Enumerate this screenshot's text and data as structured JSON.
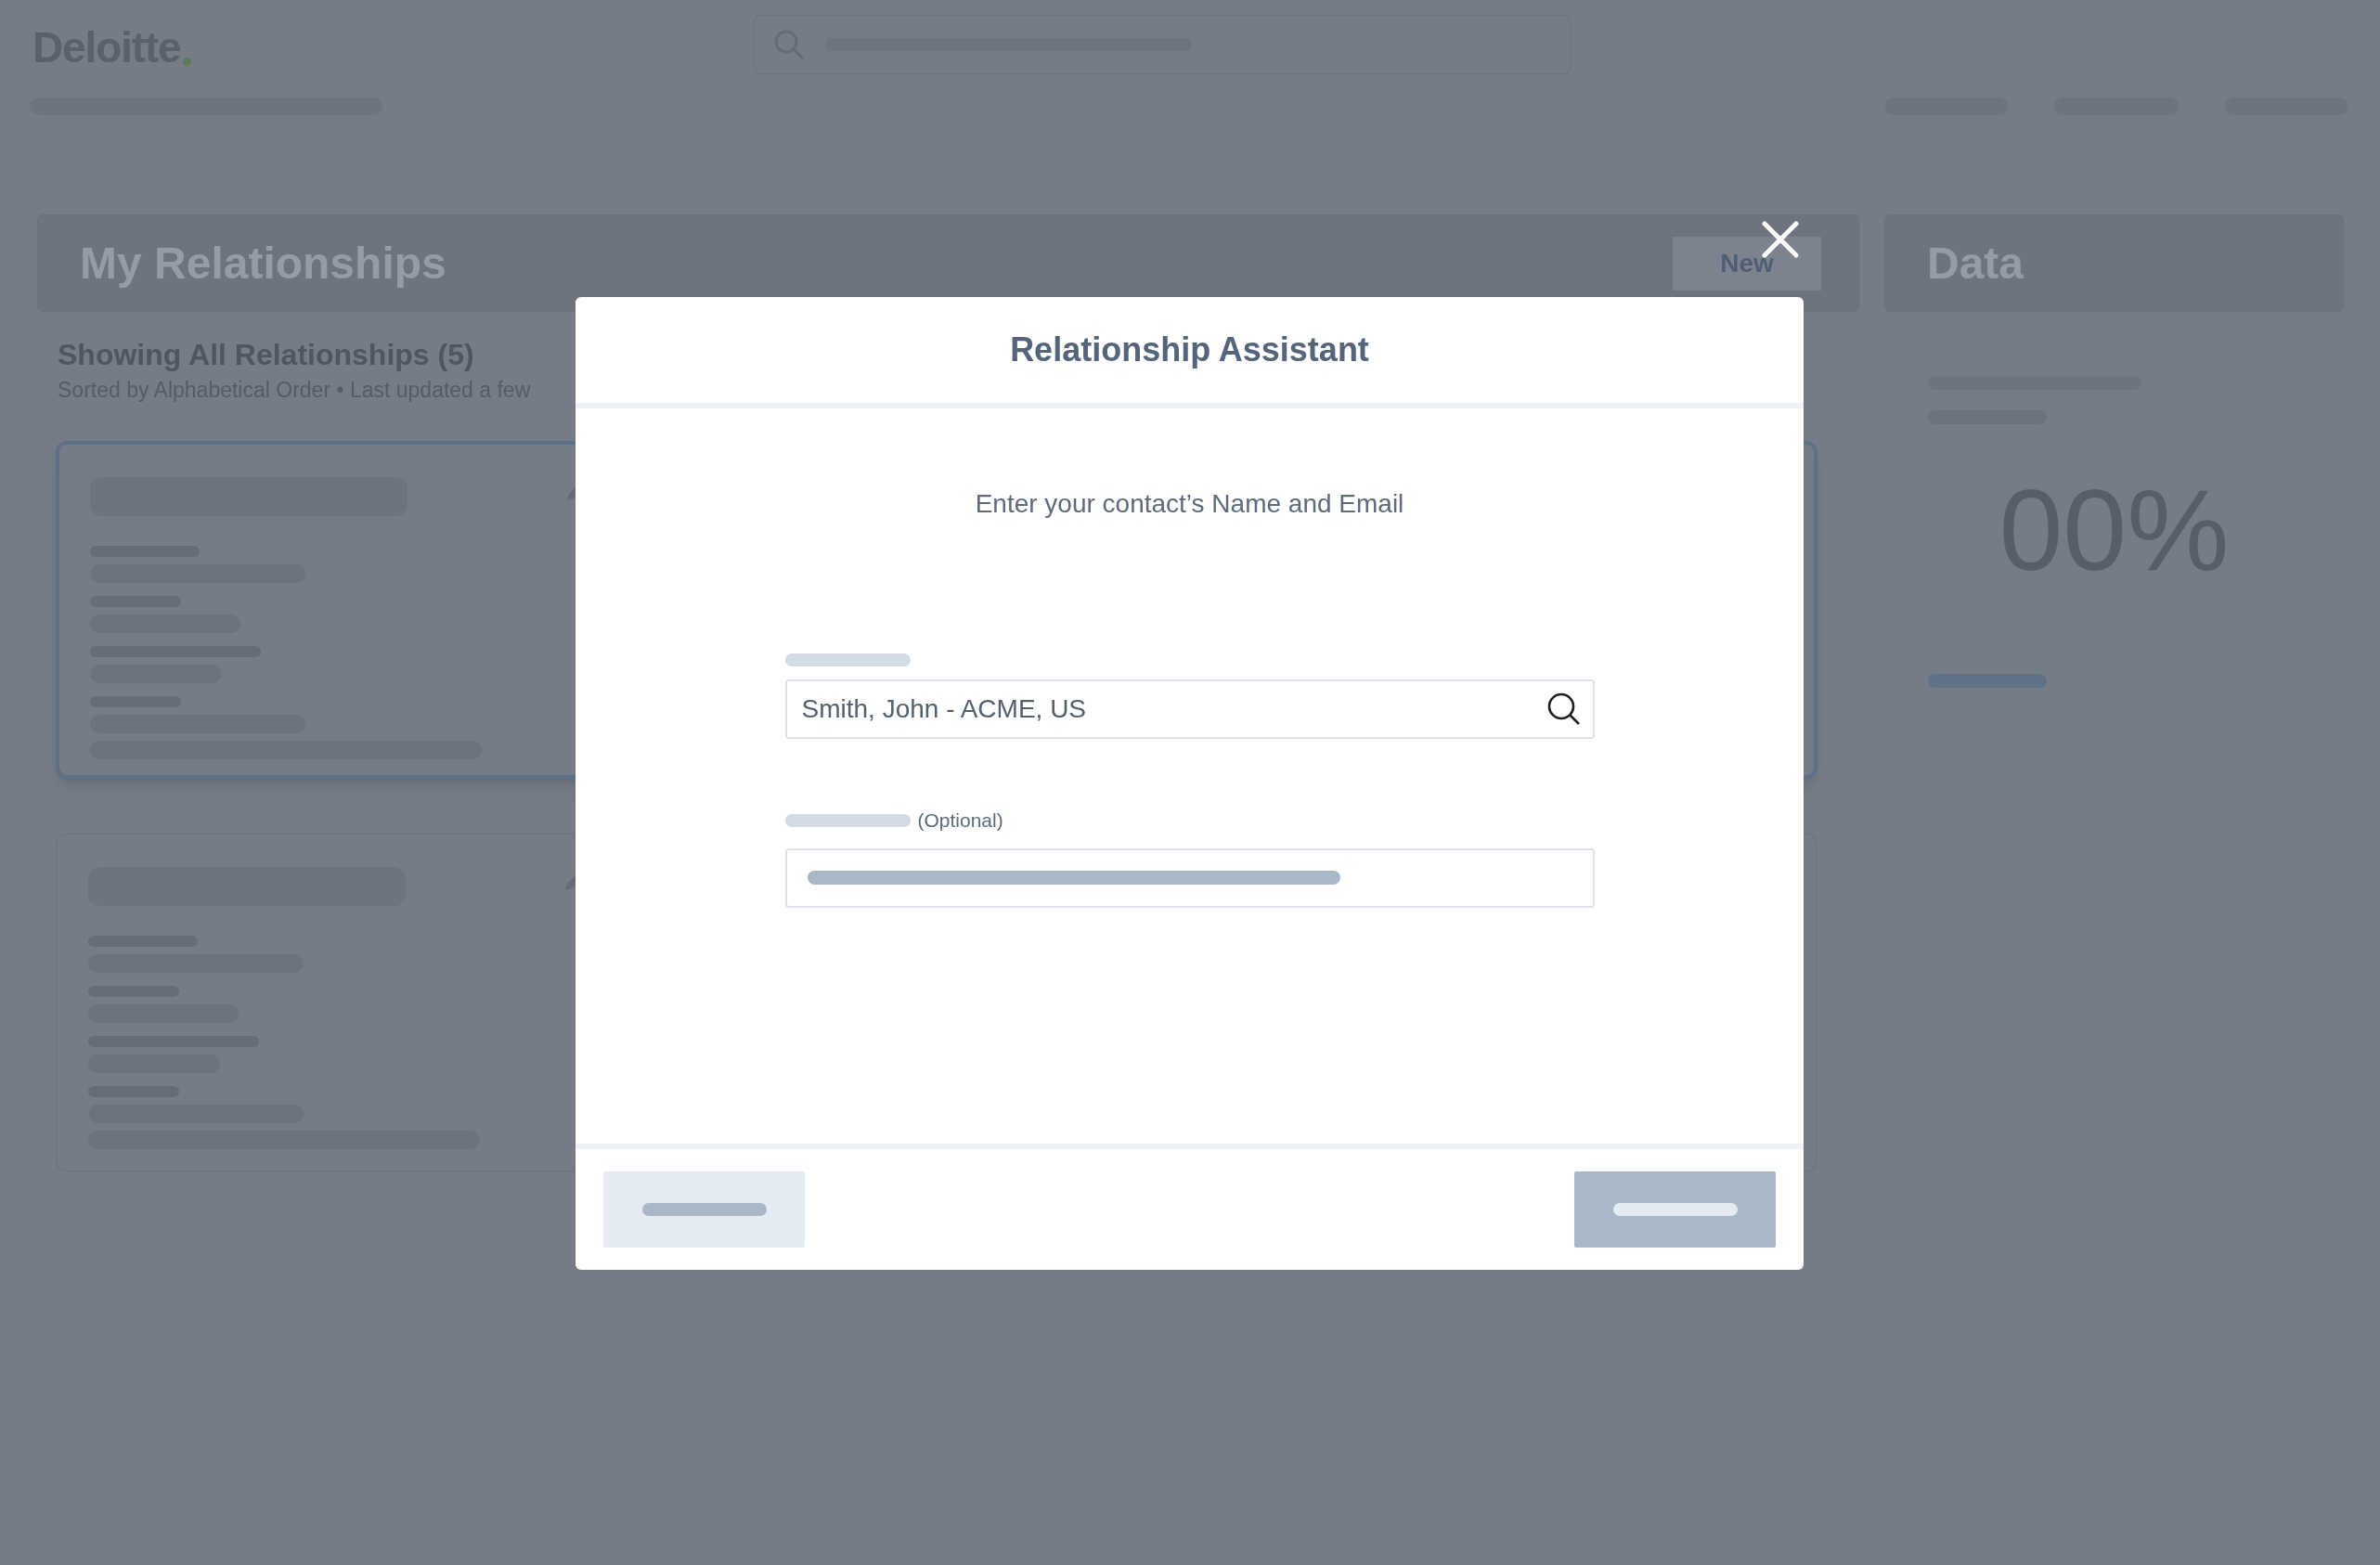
{
  "header": {
    "logo": "Deloitte"
  },
  "relationships_panel": {
    "title": "My Relationships",
    "new_button": "New",
    "heading": "Showing All Relationships (5)",
    "subheading": "Sorted by Alphabetical Order • Last updated a few"
  },
  "data_panel": {
    "title": "Data",
    "value": "00%"
  },
  "modal": {
    "title": "Relationship Assistant",
    "instruction": "Enter your contact’s Name and Email",
    "fields": [
      {
        "kind": "search",
        "value": "Smith, John - ACME, US"
      },
      {
        "kind": "plain",
        "note": "(Optional)"
      }
    ]
  }
}
